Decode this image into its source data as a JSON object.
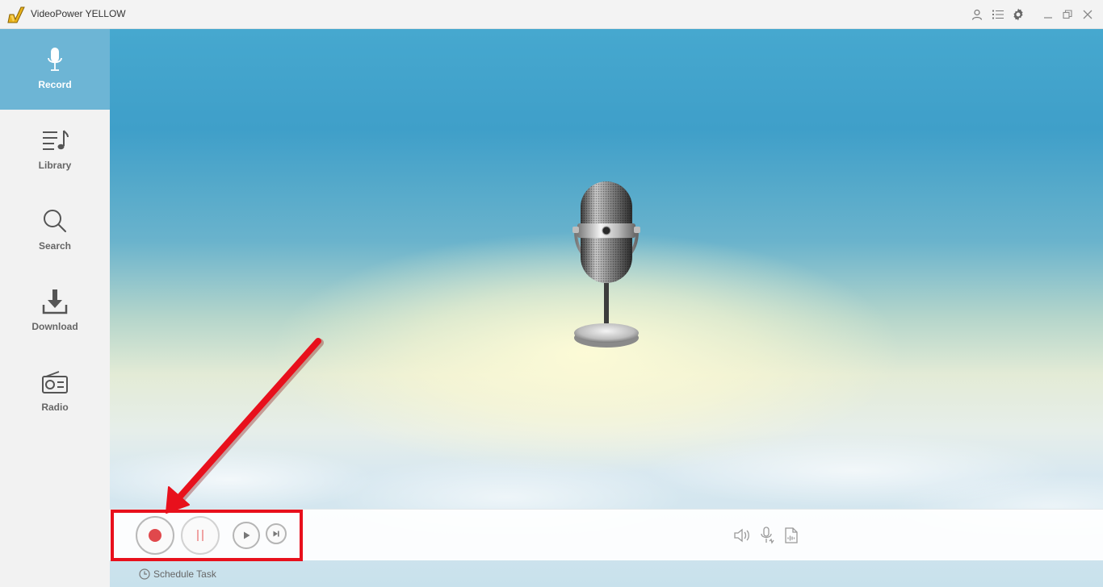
{
  "app": {
    "title": "VideoPower YELLOW"
  },
  "titlebar": {
    "icons": [
      "user-icon",
      "list-menu-icon",
      "settings-gear-icon",
      "minimize-icon",
      "restore-icon",
      "close-icon"
    ]
  },
  "sidebar": {
    "items": [
      {
        "label": "Record",
        "icon": "microphone-icon",
        "active": true
      },
      {
        "label": "Library",
        "icon": "music-list-icon",
        "active": false
      },
      {
        "label": "Search",
        "icon": "search-icon",
        "active": false
      },
      {
        "label": "Download",
        "icon": "download-icon",
        "active": false
      },
      {
        "label": "Radio",
        "icon": "radio-icon",
        "active": false
      }
    ]
  },
  "controls": {
    "buttons": [
      "record-button",
      "pause-button",
      "play-button",
      "skip-next-button"
    ],
    "right_icons": [
      "volume-icon",
      "microphone-source-icon",
      "audio-file-icon"
    ]
  },
  "schedule": {
    "label": "Schedule Task"
  },
  "colors": {
    "sidebar_active": "#6db5d5",
    "record_red": "#e0484c",
    "annotation_red": "#e8101c"
  }
}
